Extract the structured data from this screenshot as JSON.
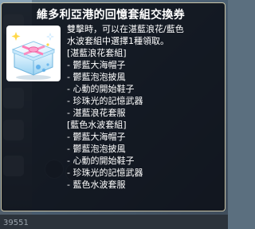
{
  "background": {
    "bottom_text": "39551"
  },
  "tooltip": {
    "title": "維多利亞港的回憶套組交換券",
    "icon": "gift-box-icon",
    "lines": [
      "雙擊時，可以在湛藍浪花/藍色",
      "水波套組中選擇1種領取。",
      "[湛藍浪花套組]",
      "- 鬱藍大海帽子",
      "- 鬱藍泡泡披風",
      "- 心動的開始鞋子",
      "- 珍珠光的記憶武器",
      "- 湛藍浪花套服",
      "[藍色水波套組]",
      "- 鬱藍大海帽子",
      "- 鬱藍泡泡披風",
      "- 心動的開始鞋子",
      "- 珍珠光的記憶武器",
      "- 藍色水波套服"
    ]
  },
  "colors": {
    "tooltip_bg": "#0a0e16",
    "tooltip_border": "#c9c3a6",
    "text": "#ffffff"
  }
}
